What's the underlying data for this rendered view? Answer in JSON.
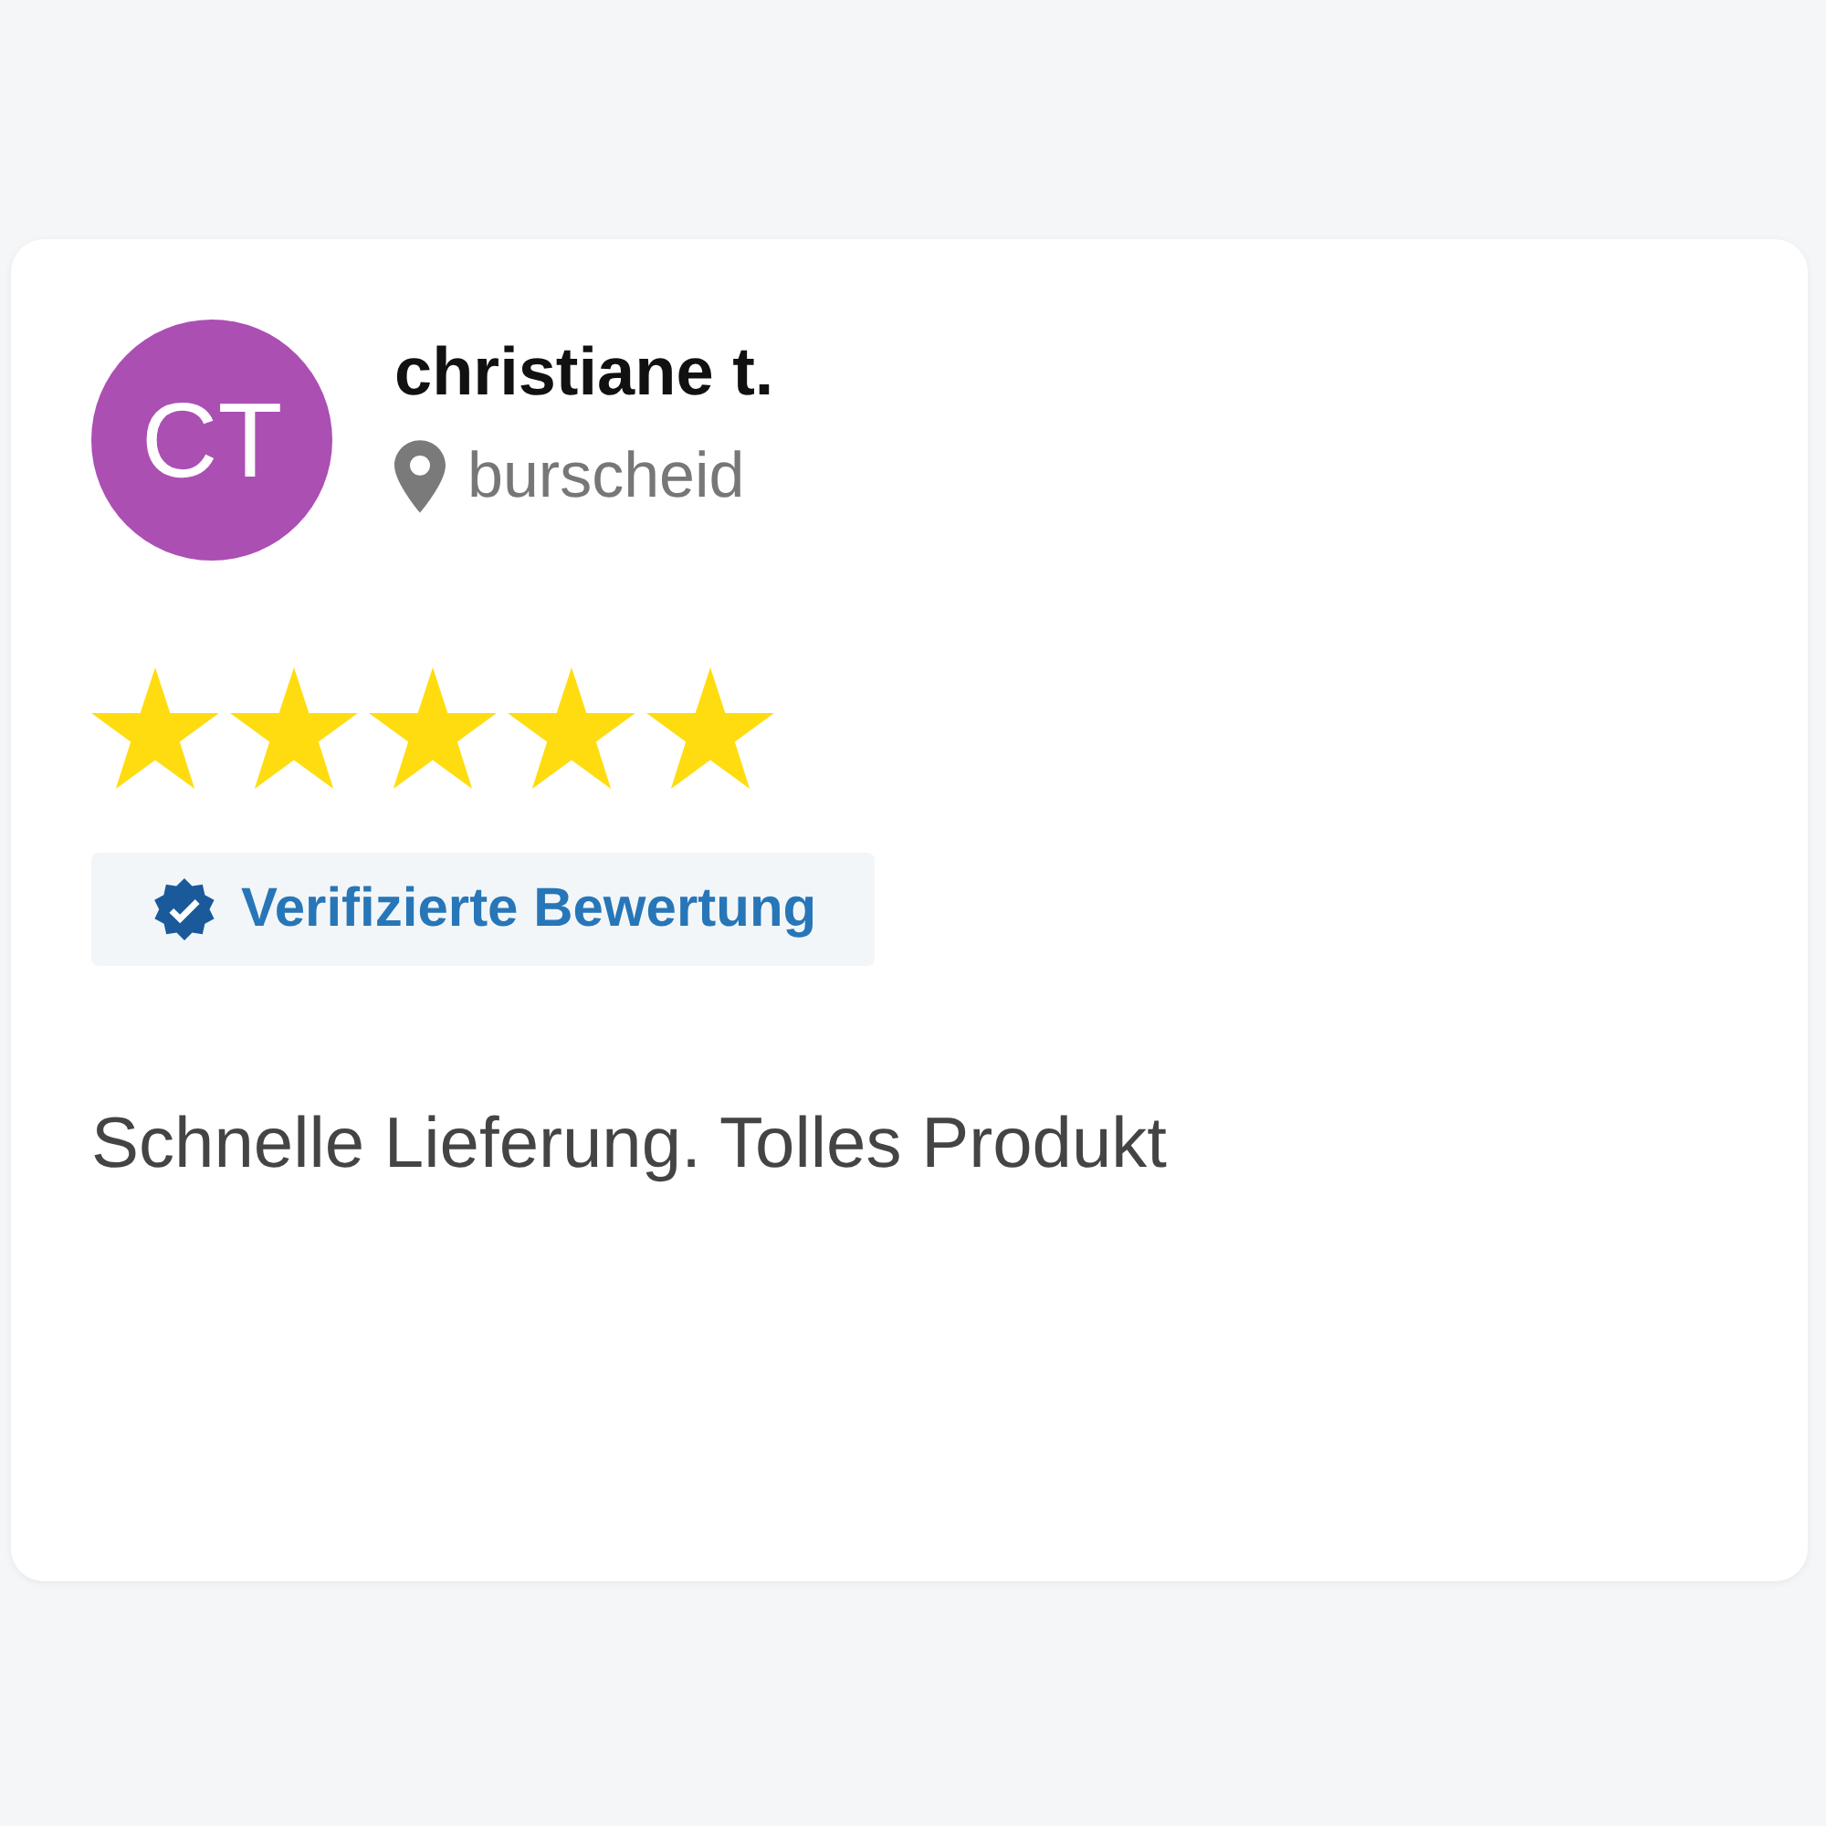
{
  "review": {
    "avatar": {
      "initials": "CT",
      "color": "#ab4fb3"
    },
    "name": "christiane t.",
    "location": "burscheid",
    "stars": 5,
    "badge": {
      "label": "Verifizierte Bewertung",
      "verified": true
    },
    "text": "Schnelle Lieferung. Tolles Produkt"
  }
}
